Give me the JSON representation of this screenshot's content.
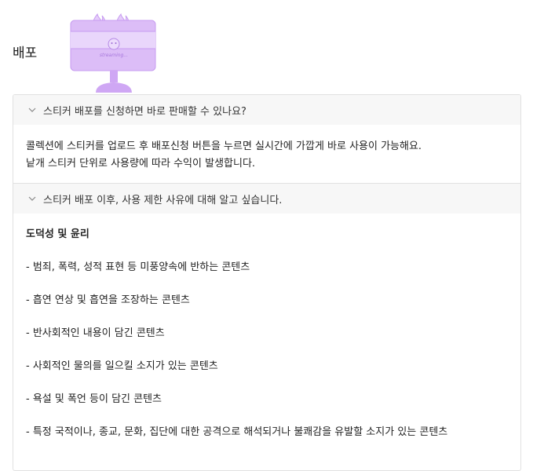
{
  "section": {
    "title": "배포"
  },
  "illustration": {
    "icon": "computer-monitor-illustration",
    "screen_text": "streaming..."
  },
  "faq": [
    {
      "question": "스티커 배포를 신청하면 바로 판매할 수 있나요?",
      "answer_lines": [
        "콜렉션에 스티커를 업로드 후 배포신청 버튼을 누르면 실시간에 가깝게 바로 사용이 가능해요.",
        "낱개 스티커 단위로 사용량에 따라 수익이 발생합니다."
      ]
    },
    {
      "question": "스티커 배포 이후, 사용 제한 사유에 대해 알고 싶습니다.",
      "subheading": "도덕성 및 윤리",
      "rules": [
        "- 범죄, 폭력, 성적 표현 등 미풍양속에 반하는 콘텐츠",
        "- 흡연 연상 및 흡연을 조장하는 콘텐츠",
        "- 반사회적인 내용이 담긴 콘텐츠",
        "- 사회적인 물의를 일으킬 소지가 있는 콘텐츠",
        "- 욕설 및 폭언 등이 담긴 콘텐츠",
        "- 특정 국적이나, 종교, 문화, 집단에 대한 공격으로 해석되거나 불쾌감을 유발할 소지가 있는 콘텐츠"
      ]
    }
  ],
  "colors": {
    "illustration": "#d8b8f5",
    "illustration_stroke": "#c79cf0",
    "header_bg": "#f7f7f7",
    "border": "#e1e1e1"
  }
}
